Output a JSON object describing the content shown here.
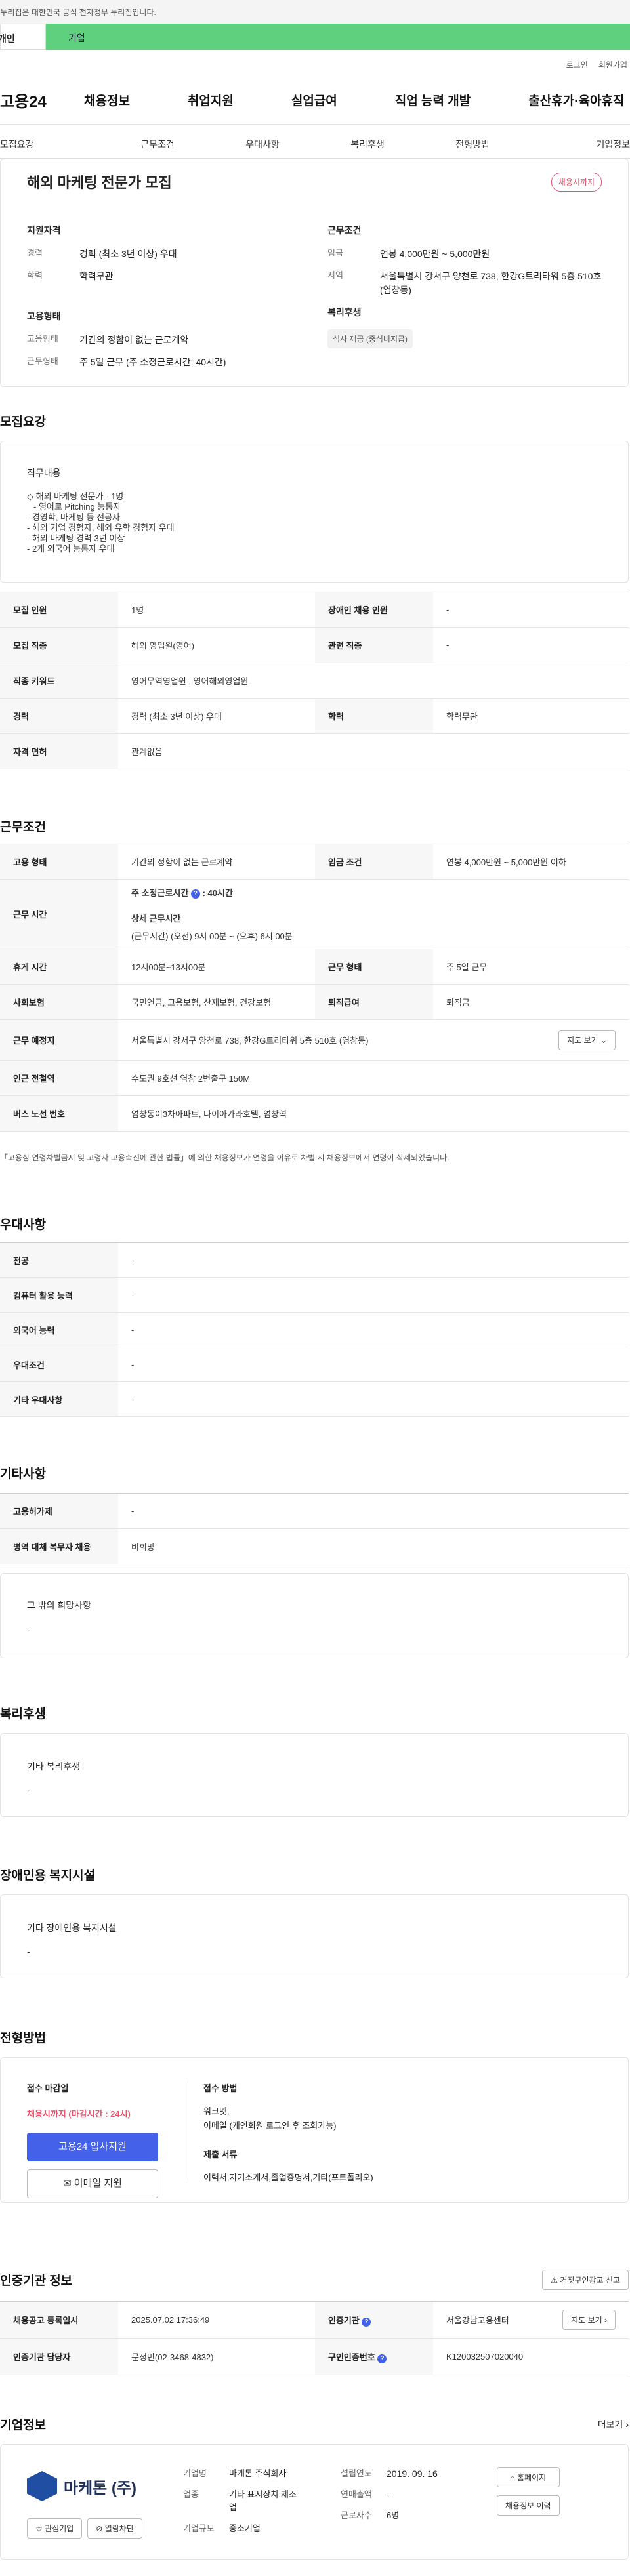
{
  "gov_banner": "이 누리집은 대한민국 공식 전자정부 누리집입니다.",
  "user_tabs": {
    "personal": "개인",
    "company": "기업"
  },
  "util_links": {
    "login": "로그인",
    "signup": "회원가입"
  },
  "gnb": {
    "logo": "고용24",
    "menus": [
      "채용정보",
      "취업지원",
      "실업급여",
      "직업 능력 개발",
      "출산휴가·육아휴직"
    ]
  },
  "subnav": [
    "모집요강",
    "근무조건",
    "우대사항",
    "복리후생",
    "전형방법",
    "기업정보"
  ],
  "summary": {
    "title": "해외 마케팅 전문가 모집",
    "status_badge": "채용시까지",
    "qual_heading": "지원자격",
    "qual_rows": [
      {
        "k": "경력",
        "v": "경력 (최소 3년 이상) 우대"
      },
      {
        "k": "학력",
        "v": "학력무관"
      }
    ],
    "emp_heading": "고용형태",
    "emp_rows": [
      {
        "k": "고용형태",
        "v": "기간의 정함이 없는 근로계약"
      },
      {
        "k": "근무형태",
        "v": "주 5일 근무 (주 소정근로시간: 40시간)"
      }
    ],
    "work_heading": "근무조건",
    "work_rows": [
      {
        "k": "임금",
        "v": "연봉 4,000만원 ~ 5,000만원"
      },
      {
        "k": "지역",
        "v": "서울특별시 강서구 양천로 738, 한강G트리타워 5층 510호 (염창동)"
      }
    ],
    "welfare_heading": "복리후생",
    "welfare_chip": "식사 제공 (중식비지급)"
  },
  "recruit": {
    "title": "모집요강",
    "duty_heading": "직무내용",
    "duty_lines": [
      "◇ 해외 마케팅 전문가 - 1명",
      "- 영어로 Pitching 능통자",
      "- 경영학, 마케팅 등 전공자",
      "- 해외 기업 경험자, 해외 유학 경험자 우대",
      "- 해외 마케팅 경력 3년 이상",
      "- 2개 외국어 능통자 우대"
    ],
    "rows": [
      {
        "k1": "모집 인원",
        "v1": "1명",
        "k2": "장애인 채용 인원",
        "v2": "-"
      },
      {
        "k1": "모집 직종",
        "v1": "해외 영업원(영어)",
        "k2": "관련 직종",
        "v2": "-"
      },
      {
        "k1": "직종 키워드",
        "v1": "영어무역영업원 , 영어해외영업원"
      },
      {
        "k1": "경력",
        "v1": "경력 (최소 3년 이상) 우대",
        "k2": "학력",
        "v2": "학력무관"
      },
      {
        "k1": "자격 면허",
        "v1": "관계없음"
      }
    ]
  },
  "work": {
    "title": "근무조건",
    "emp_type_k": "고용 형태",
    "emp_type_v": "기간의 정함이 없는 근로계약",
    "wage_k": "임금 조건",
    "wage_v": "연봉 4,000만원 ~ 5,000만원 이하",
    "hours_k": "근무 시간",
    "hours_weekly": "주 소정근로시간",
    "hours_weekly_value": ": 40시간",
    "hours_detail_label": "상세 근무시간",
    "hours_detail": "(근무시간) (오전) 9시 00분 ~ (오후) 6시 00분",
    "break_k": "휴게 시간",
    "break_v": "12시00분~13시00분",
    "shift_k": "근무 형태",
    "shift_v": "주 5일 근무",
    "insurance_k": "사회보험",
    "insurance_v": "국민연금, 고용보험, 산재보험, 건강보험",
    "severance_k": "퇴직급여",
    "severance_v": "퇴직금",
    "place_k": "근무 예정지",
    "place_v": "서울특별시 강서구 양천로 738, 한강G트리타워 5층 510호 (염창동)",
    "map_btn": "지도 보기",
    "station_k": "인근 전철역",
    "station_v": "수도권 9호선 염창 2번출구 150M",
    "bus_k": "버스 노선 번호",
    "bus_v": "염창동이3차아파트, 나이아가라호텔, 염창역",
    "note": "「고용상 연령차별금지 및 고령자 고용촉진에 관한 법률」에 의한 채용정보가 연령을 이유로 차별 시 채용정보에서 연령이 삭제되었습니다."
  },
  "pref": {
    "title": "우대사항",
    "rows": [
      {
        "k": "전공",
        "v": "-"
      },
      {
        "k": "컴퓨터 활용 능력",
        "v": "-"
      },
      {
        "k": "외국어 능력",
        "v": "-"
      },
      {
        "k": "우대조건",
        "v": "-"
      },
      {
        "k": "기타 우대사항",
        "v": "-"
      }
    ]
  },
  "etc": {
    "title": "기타사항",
    "rows": [
      {
        "k": "고용허가제",
        "v": "-"
      },
      {
        "k": "병역 대체 복무자 채용",
        "v": "비희망"
      }
    ],
    "hope_heading": "그 밖의 희망사항",
    "hope_value": "-"
  },
  "welfare": {
    "title": "복리후생",
    "heading": "기타 복리후생",
    "value": "-"
  },
  "disabled": {
    "title": "장애인용 복지시설",
    "heading": "기타 장애인용 복지시설",
    "value": "-"
  },
  "selection": {
    "title": "전형방법",
    "deadline_label": "접수 마감일",
    "deadline_value": "채용시까지 (마감시간 : 24시)",
    "apply_btn": "고용24 입사지원",
    "email_btn": "이메일 지원",
    "method_label": "접수 방법",
    "method_lines": [
      "워크넷,",
      "이메일 (개인회원 로그인 후 조회가능)"
    ],
    "docs_label": "제출 서류",
    "docs_value": "이력서,자기소개서,졸업증명서,기타(포트폴리오)"
  },
  "cert": {
    "title": "인증기관 정보",
    "report_btn": "거짓구인광고 신고",
    "reg_k": "채용공고 등록일시",
    "reg_v": "2025.07.02 17:36:49",
    "agency_k": "인증기관",
    "agency_v": "서울강남고용센터",
    "manager_k": "인증기관 담당자",
    "manager_v": "문정민(02-3468-4832)",
    "reqno_k": "구인인증번호",
    "reqno_v": "K120032507020040",
    "map_btn": "지도 보기"
  },
  "company": {
    "title": "기업정보",
    "more": "더보기",
    "logo_text": "마케톤 (주)",
    "interest_btn": "관심기업",
    "block_btn": "열람차단",
    "name_k": "기업명",
    "name_v": "마케톤 주식회사",
    "industry_k": "업종",
    "industry_v": "기타 표시장치 제조업",
    "size_k": "기업규모",
    "size_v": "중소기업",
    "est_k": "설립연도",
    "est_v": "2019. 09. 16",
    "sales_k": "연매출액",
    "sales_v": "-",
    "emp_k": "근로자수",
    "emp_v": "6명",
    "homepage_btn": "홈페이지",
    "history_btn": "채용정보 이력"
  },
  "colors": {
    "accent": "#4461ea",
    "green_tab": "#5fd17e",
    "red": "#e8536b"
  }
}
